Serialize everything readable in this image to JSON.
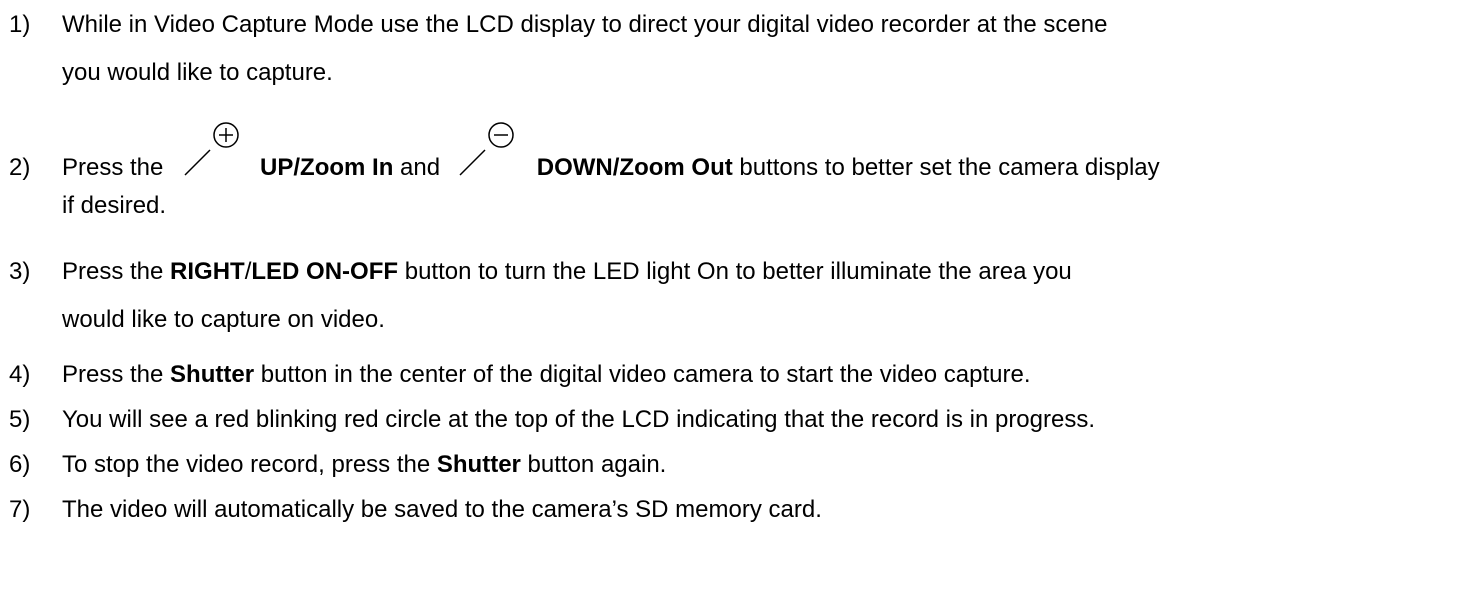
{
  "steps": [
    {
      "num": "1)",
      "line1": "While in Video Capture Mode use the LCD display to direct your digital video recorder at the scene",
      "line2": "you would like to capture."
    },
    {
      "num": "2)",
      "press": "Press the ",
      "zoom_in_icon": "zoom-in-icon",
      "zoom_in_label": "UP/Zoom In",
      "and": " and ",
      "zoom_out_icon": "zoom-out-icon",
      "zoom_out_label": "DOWN/Zoom Out",
      "rest": " buttons to better set the camera display",
      "line2": "if desired."
    },
    {
      "num": "3)",
      "press": "Press the ",
      "right": "RIGHT",
      "slash": "/",
      "led": "LED ON-OFF",
      "rest": " button to turn the LED light On to better illuminate the area you",
      "line2": "would like to capture on video."
    },
    {
      "num": "4)",
      "press": "Press the ",
      "shutter": "Shutter",
      "rest": " button in the center of the digital video camera to start the video capture."
    },
    {
      "num": "5)",
      "text": "You will see a red blinking red circle at the top of the LCD indicating that the record is in progress."
    },
    {
      "num": "6)",
      "press": "To stop the video record, press the ",
      "shutter": "Shutter",
      "rest": " button again."
    },
    {
      "num": "7)",
      "text": "The video will automatically be saved to the camera’s SD memory card."
    }
  ]
}
